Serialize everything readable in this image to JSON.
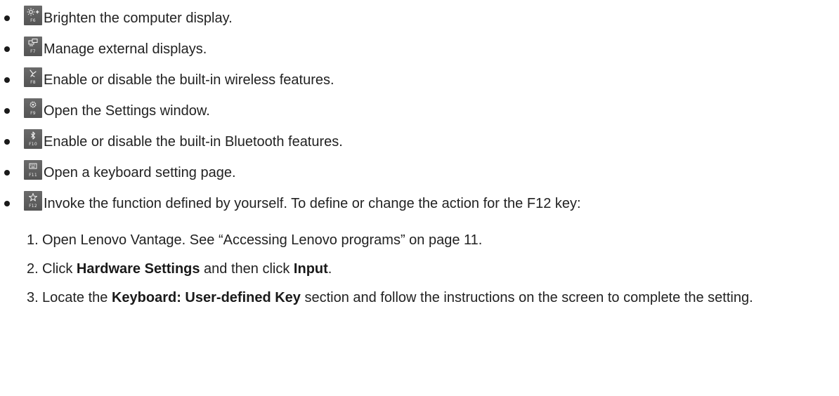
{
  "items": [
    {
      "key": "F6",
      "icon": "brightness-up-icon",
      "text": "Brighten the computer display."
    },
    {
      "key": "F7",
      "icon": "external-display-icon",
      "text": "Manage external displays."
    },
    {
      "key": "F8",
      "icon": "airplane-mode-icon",
      "text": "Enable or disable the built-in wireless features."
    },
    {
      "key": "F9",
      "icon": "settings-gear-icon",
      "text": "Open the Settings window."
    },
    {
      "key": "F10",
      "icon": "bluetooth-icon",
      "text": "Enable or disable the built-in Bluetooth features."
    },
    {
      "key": "F11",
      "icon": "keyboard-icon",
      "text": "Open a keyboard setting page."
    },
    {
      "key": "F12",
      "icon": "star-icon",
      "text": "Invoke the function defined by yourself. To define or change the action for the F12 key:"
    }
  ],
  "steps": [
    {
      "number": "1.",
      "parts": [
        "Open Lenovo Vantage. See “Accessing Lenovo programs” on page 11."
      ]
    },
    {
      "number": "2.",
      "parts": [
        "Click ",
        "Hardware Settings",
        " and then click ",
        "Input",
        "."
      ]
    },
    {
      "number": "3.",
      "parts": [
        "Locate the ",
        "Keyboard: User-defined Key",
        " section and follow the instructions on the screen to complete the setting."
      ]
    }
  ]
}
